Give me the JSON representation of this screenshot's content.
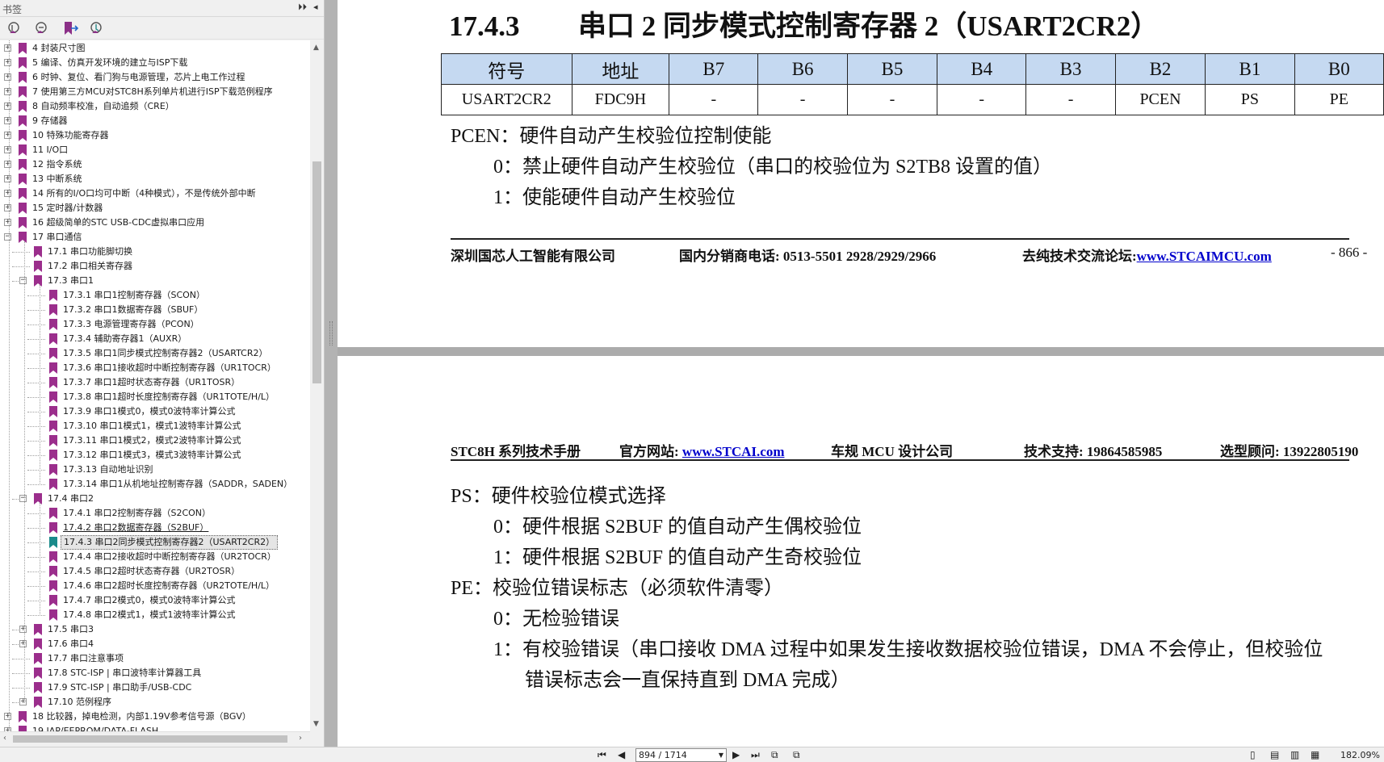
{
  "sidebar": {
    "title": "书签",
    "collapse_glyph": "⏵⏵",
    "close_glyph": "◂",
    "tree": [
      {
        "label": "4  封装尺寸图",
        "level": 0,
        "exp": "+"
      },
      {
        "label": "5  编译、仿真开发环境的建立与ISP下载",
        "level": 0,
        "exp": "+"
      },
      {
        "label": "6  时钟、复位、看门狗与电源管理，芯片上电工作过程",
        "level": 0,
        "exp": "+"
      },
      {
        "label": "7  使用第三方MCU对STC8H系列单片机进行ISP下载范例程序",
        "level": 0,
        "exp": "+"
      },
      {
        "label": "8  自动频率校准，自动追频（CRE）",
        "level": 0,
        "exp": "+"
      },
      {
        "label": "9  存储器",
        "level": 0,
        "exp": "+"
      },
      {
        "label": "10  特殊功能寄存器",
        "level": 0,
        "exp": "+"
      },
      {
        "label": "11  I/O口",
        "level": 0,
        "exp": "+"
      },
      {
        "label": "12  指令系统",
        "level": 0,
        "exp": "+"
      },
      {
        "label": "13  中断系统",
        "level": 0,
        "exp": "+"
      },
      {
        "label": "14  所有的I/O口均可中断（4种模式），不是传统外部中断",
        "level": 0,
        "exp": "+"
      },
      {
        "label": "15  定时器/计数器",
        "level": 0,
        "exp": "+"
      },
      {
        "label": "16  超级简单的STC USB-CDC虚拟串口应用",
        "level": 0,
        "exp": "+"
      },
      {
        "label": "17  串口通信",
        "level": 0,
        "exp": "-"
      },
      {
        "label": "17.1  串口功能脚切换",
        "level": 1,
        "exp": ""
      },
      {
        "label": "17.2  串口相关寄存器",
        "level": 1,
        "exp": ""
      },
      {
        "label": "17.3  串口1",
        "level": 1,
        "exp": "-"
      },
      {
        "label": "17.3.1 串口1控制寄存器（SCON）",
        "level": 2,
        "exp": ""
      },
      {
        "label": "17.3.2  串口1数据寄存器（SBUF）",
        "level": 2,
        "exp": ""
      },
      {
        "label": "17.3.3 电源管理寄存器（PCON）",
        "level": 2,
        "exp": ""
      },
      {
        "label": "17.3.4 辅助寄存器1（AUXR）",
        "level": 2,
        "exp": ""
      },
      {
        "label": "17.3.5 串口1同步模式控制寄存器2（USARTCR2）",
        "level": 2,
        "exp": ""
      },
      {
        "label": "17.3.6 串口1接收超时中断控制寄存器（UR1TOCR）",
        "level": 2,
        "exp": ""
      },
      {
        "label": "17.3.7 串口1超时状态寄存器（UR1TOSR）",
        "level": 2,
        "exp": ""
      },
      {
        "label": "17.3.8 串口1超时长度控制寄存器（UR1TOTE/H/L）",
        "level": 2,
        "exp": ""
      },
      {
        "label": "17.3.9  串口1模式0，模式0波特率计算公式",
        "level": 2,
        "exp": ""
      },
      {
        "label": "17.3.10 串口1模式1，模式1波特率计算公式",
        "level": 2,
        "exp": ""
      },
      {
        "label": "17.3.11 串口1模式2，模式2波特率计算公式",
        "level": 2,
        "exp": ""
      },
      {
        "label": "17.3.12  串口1模式3，模式3波特率计算公式",
        "level": 2,
        "exp": ""
      },
      {
        "label": "17.3.13  自动地址识别",
        "level": 2,
        "exp": ""
      },
      {
        "label": "17.3.14 串口1从机地址控制寄存器（SADDR，SADEN）",
        "level": 2,
        "exp": ""
      },
      {
        "label": "17.4  串口2",
        "level": 1,
        "exp": "-"
      },
      {
        "label": "17.4.1 串口2控制寄存器（S2CON）",
        "level": 2,
        "exp": ""
      },
      {
        "label": "17.4.2 串口2数据寄存器（S2BUF）",
        "level": 2,
        "exp": "",
        "underline": true
      },
      {
        "label": "17.4.3 串口2同步模式控制寄存器2（USART2CR2）",
        "level": 2,
        "exp": "",
        "selected": true
      },
      {
        "label": "17.4.4 串口2接收超时中断控制寄存器（UR2TOCR）",
        "level": 2,
        "exp": ""
      },
      {
        "label": "17.4.5 串口2超时状态寄存器（UR2TOSR）",
        "level": 2,
        "exp": ""
      },
      {
        "label": "17.4.6  串口2超时长度控制寄存器（UR2TOTE/H/L）",
        "level": 2,
        "exp": ""
      },
      {
        "label": "17.4.7  串口2模式0，模式0波特率计算公式",
        "level": 2,
        "exp": ""
      },
      {
        "label": "17.4.8  串口2模式1，模式1波特率计算公式",
        "level": 2,
        "exp": ""
      },
      {
        "label": "17.5  串口3",
        "level": 1,
        "exp": "+"
      },
      {
        "label": "17.6  串口4",
        "level": 1,
        "exp": "+"
      },
      {
        "label": "17.7  串口注意事项",
        "level": 1,
        "exp": ""
      },
      {
        "label": "17.8  STC-ISP | 串口波特率计算器工具",
        "level": 1,
        "exp": ""
      },
      {
        "label": "17.9  STC-ISP | 串口助手/USB-CDC",
        "level": 1,
        "exp": ""
      },
      {
        "label": "17.10  范例程序",
        "level": 1,
        "exp": "+"
      },
      {
        "label": "18  比较器，掉电检测，内部1.19V参考信号源（BGV）",
        "level": 0,
        "exp": "+"
      },
      {
        "label": "19  IAP/EEPROM/DATA-FLASH",
        "level": 0,
        "exp": "+"
      }
    ]
  },
  "page_top": {
    "section_number": "17.4.3",
    "section_title": "串口 2 同步模式控制寄存器 2（USART2CR2）",
    "table": {
      "headers": [
        "符号",
        "地址",
        "B7",
        "B6",
        "B5",
        "B4",
        "B3",
        "B2",
        "B1",
        "B0"
      ],
      "row": [
        "USART2CR2",
        "FDC9H",
        "-",
        "-",
        "-",
        "-",
        "-",
        "PCEN",
        "PS",
        "PE"
      ]
    },
    "pcen": {
      "title": "PCEN：硬件自动产生校验位控制使能",
      "opt0": "0：禁止硬件自动产生校验位（串口的校验位为 S2TB8 设置的值）",
      "opt1": "1：使能硬件自动产生校验位"
    },
    "footer": {
      "company": "深圳国芯人工智能有限公司",
      "phone": "国内分销商电话: 0513-5501 2928/2929/2966",
      "forum_label": "去纯技术交流论坛:",
      "forum_link": "www.STCAIMCU.com",
      "page": "- 866 -"
    }
  },
  "page_bottom": {
    "header": {
      "manual": "STC8H 系列技术手册",
      "site_label": "官方网站: ",
      "site_link": "www.STCAI.com",
      "company": "车规 MCU 设计公司",
      "support": "技术支持: 19864585985",
      "advisor": "选型顾问: 13922805190"
    },
    "ps": {
      "title": "PS：硬件校验位模式选择",
      "opt0": "0：硬件根据 S2BUF 的值自动产生偶校验位",
      "opt1": "1：硬件根据 S2BUF 的值自动产生奇校验位"
    },
    "pe": {
      "title": "PE：校验位错误标志（必须软件清零）",
      "opt0": "0：无检验错误",
      "opt1_line1": "1：有校验错误（串口接收 DMA 过程中如果发生接收数据校验位错误，DMA 不会停止，但校验位",
      "opt1_line2": "错误标志会一直保持直到 DMA 完成）"
    }
  },
  "statusbar": {
    "page_field": "894 / 1714",
    "zoom": "182.09%"
  },
  "colors": {
    "table_header_bg": "#c5d9f1",
    "bookmark_purple": "#9b2e8c",
    "bookmark_teal": "#1a8a8a",
    "link_blue": "#0000cc"
  }
}
